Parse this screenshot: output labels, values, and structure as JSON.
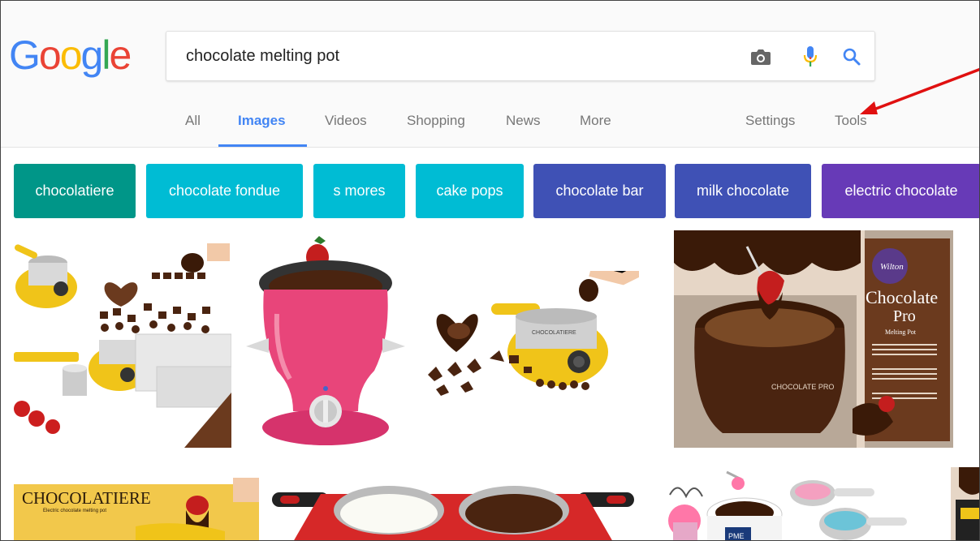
{
  "search": {
    "query": "chocolate melting pot"
  },
  "logo": {
    "letters": [
      "G",
      "o",
      "o",
      "g",
      "l",
      "e"
    ],
    "colors": [
      "#4285f4",
      "#ea4335",
      "#fbbc05",
      "#4285f4",
      "#34a853",
      "#ea4335"
    ]
  },
  "icons": {
    "camera": "camera-icon",
    "mic": "mic-icon",
    "search": "search-icon"
  },
  "tabs": {
    "all": "All",
    "images": "Images",
    "videos": "Videos",
    "shopping": "Shopping",
    "news": "News",
    "more": "More",
    "settings": "Settings",
    "tools": "Tools"
  },
  "chips": [
    {
      "label": "chocolatiere",
      "color": "#009688"
    },
    {
      "label": "chocolate fondue",
      "color": "#00bcd4"
    },
    {
      "label": "s mores",
      "color": "#00bcd4"
    },
    {
      "label": "cake pops",
      "color": "#00bcd4"
    },
    {
      "label": "chocolate bar",
      "color": "#3f51b5"
    },
    {
      "label": "milk chocolate",
      "color": "#3f51b5"
    },
    {
      "label": "electric chocolate",
      "color": "#673ab7"
    }
  ],
  "images": {
    "wilton_brand": "Wilton",
    "wilton_title_1": "Chocolate",
    "wilton_title_2": "Pro",
    "wilton_subtitle": "Melting Pot",
    "wilton_pot_label": "CHOCOLATE PRO",
    "chocolatiere_title": "CHOCOLATIERE",
    "chocolatiere_subtitle": "Electric chocolate melting pot",
    "pot3_brand": "CHOCOLATIERE",
    "pot6_label": "PME"
  },
  "annotation": {
    "arrow_color": "#e01010"
  }
}
